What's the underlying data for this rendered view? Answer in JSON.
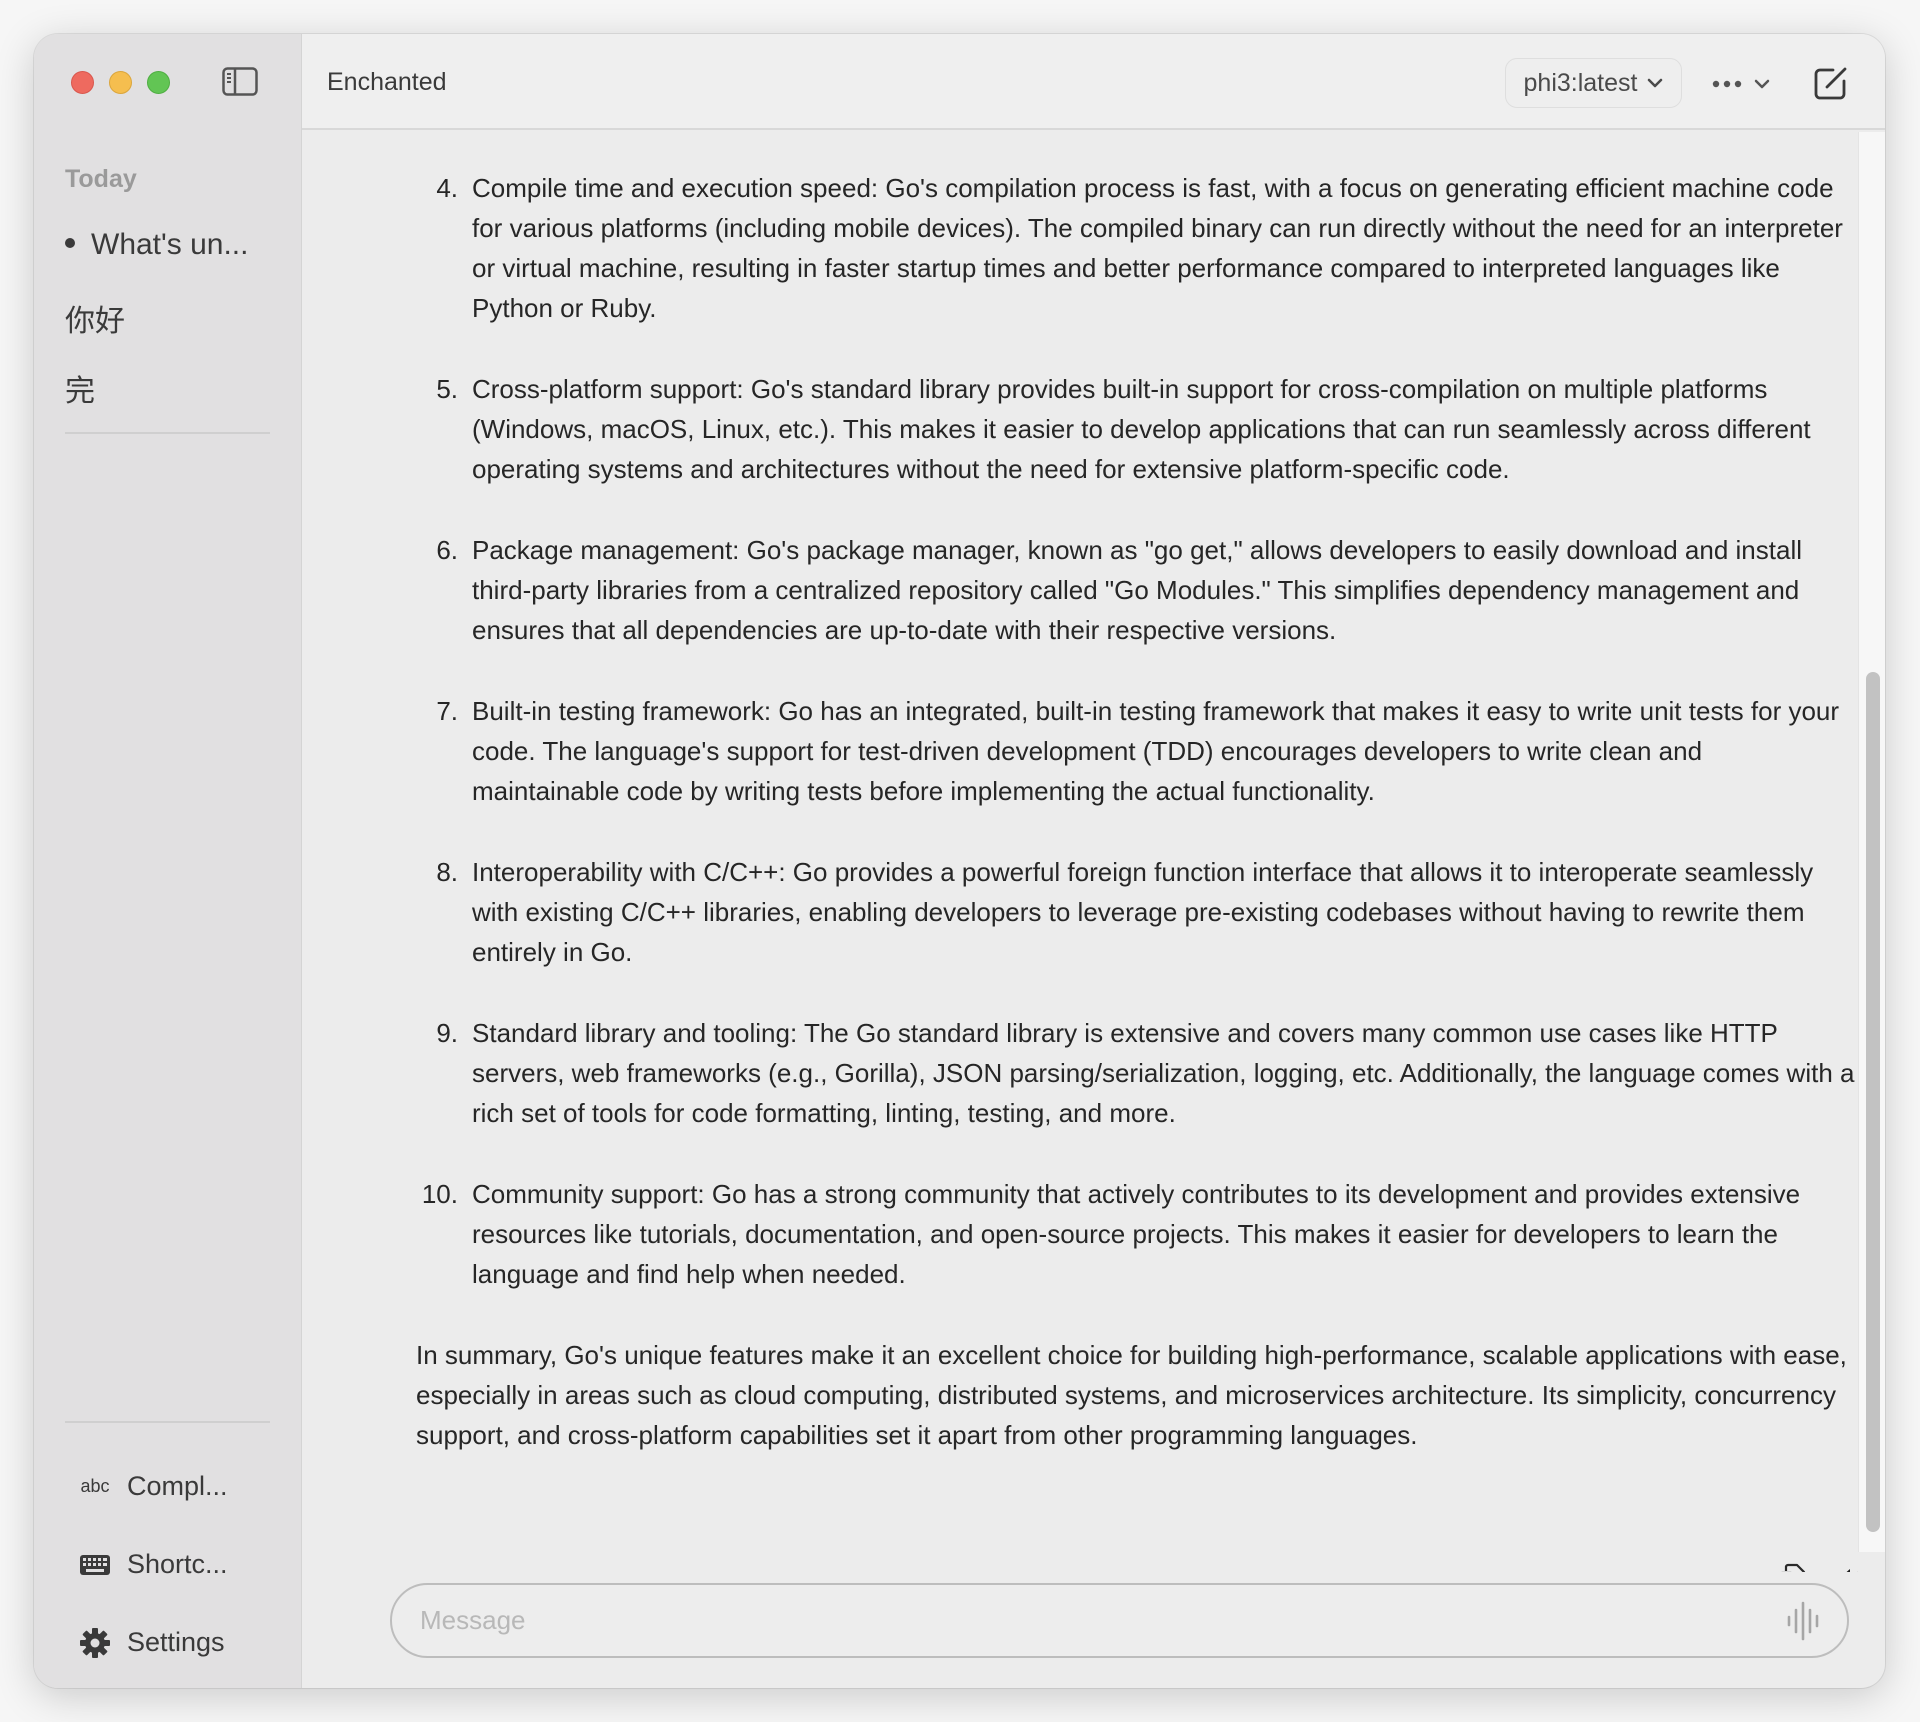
{
  "window": {
    "traffic_lights": {
      "close": "#ee6a5f",
      "minimize": "#f5be4f",
      "zoom": "#62c554"
    }
  },
  "sidebar": {
    "toggle_icon": "sidebar-toggle-icon",
    "section_label": "Today",
    "conversations": [
      {
        "label": "What's un...",
        "active": true
      },
      {
        "label": "你好",
        "active": false
      },
      {
        "label": "完",
        "active": false
      }
    ],
    "bottom_items": [
      {
        "icon": "abc",
        "label": "Compl..."
      },
      {
        "icon": "keyboard-icon",
        "label": "Shortc..."
      },
      {
        "icon": "gear-icon",
        "label": "Settings"
      }
    ]
  },
  "header": {
    "title": "Enchanted",
    "model_selector": "phi3:latest",
    "more_icon": "ellipsis-icon",
    "compose_icon": "compose-icon"
  },
  "message": {
    "list_items": [
      {
        "number": "4.",
        "text": "Compile time and execution speed: Go's compilation process is fast, with a focus on generating efficient machine code for various platforms (including mobile devices). The compiled binary can run directly without the need for an interpreter or virtual machine, resulting in faster startup times and better performance compared to interpreted languages like Python or Ruby."
      },
      {
        "number": "5.",
        "text": "Cross-platform support: Go's standard library provides built-in support for cross-compilation on multiple platforms (Windows, macOS, Linux, etc.). This makes it easier to develop applications that can run seamlessly across different operating systems and architectures without the need for extensive platform-specific code."
      },
      {
        "number": "6.",
        "text": "Package management: Go's package manager, known as \"go get,\" allows developers to easily download and install third-party libraries from a centralized repository called \"Go Modules.\" This simplifies dependency management and ensures that all dependencies are up-to-date with their respective versions."
      },
      {
        "number": "7.",
        "text": "Built-in testing framework: Go has an integrated, built-in testing framework that makes it easy to write unit tests for your code. The language's support for test-driven development (TDD) encourages developers to write clean and maintainable code by writing tests before implementing the actual functionality."
      },
      {
        "number": "8.",
        "text": "Interoperability with C/C++: Go provides a powerful foreign function interface that allows it to interoperate seamlessly with existing C/C++ libraries, enabling developers to leverage pre-existing codebases without having to rewrite them entirely in Go."
      },
      {
        "number": "9.",
        "text": "Standard library and tooling: The Go standard library is extensive and covers many common use cases like HTTP servers, web frameworks (e.g., Gorilla), JSON parsing/serialization, logging, etc. Additionally, the language comes with a rich set of tools for code formatting, linting, testing, and more."
      },
      {
        "number": "10.",
        "text": "Community support: Go has a strong community that actively contributes to its development and provides extensive resources like tutorials, documentation, and open-source projects. This makes it easier for developers to learn the language and find help when needed."
      }
    ],
    "summary": "In summary, Go's unique features make it an excellent choice for building high-performance, scalable applications with ease, especially in areas such as cloud computing, distributed systems, and microservices architecture. Its simplicity, concurrency support, and cross-platform capabilities set it apart from other programming languages.",
    "actions": {
      "copy_icon": "copy-icon",
      "speak_icon": "speaker-icon"
    }
  },
  "annotation": {
    "arrow_color": "#e8322a"
  },
  "composer": {
    "placeholder": "Message",
    "value": "",
    "voice_icon": "waveform-icon"
  }
}
